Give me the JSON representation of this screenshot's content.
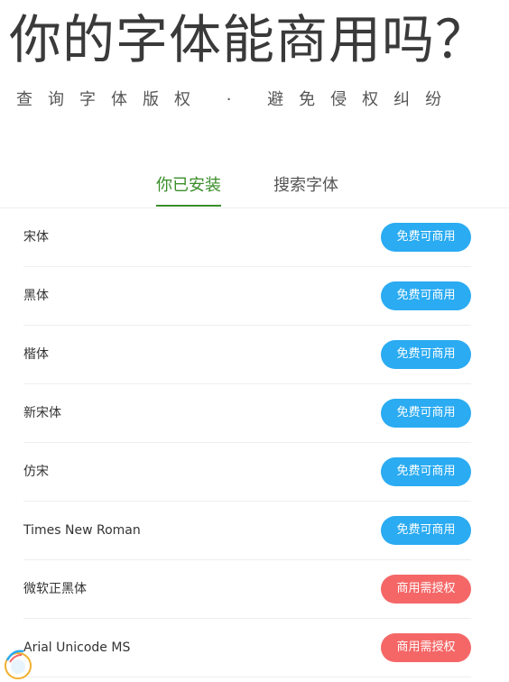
{
  "hero": {
    "title": "你的字体能商用吗？",
    "subtitle": "查询字体版权 · 避免侵权纠纷"
  },
  "tabs": [
    {
      "label": "你已安装",
      "active": true
    },
    {
      "label": "搜索字体",
      "active": false
    }
  ],
  "colors": {
    "accent_green": "#3a8e2a",
    "free_badge": "#2aabf2",
    "paid_badge": "#f56767"
  },
  "fonts": [
    {
      "name": "宋体",
      "license": "免费可商用",
      "status": "free"
    },
    {
      "name": "黑体",
      "license": "免费可商用",
      "status": "free"
    },
    {
      "name": "楷体",
      "license": "免费可商用",
      "status": "free"
    },
    {
      "name": "新宋体",
      "license": "免费可商用",
      "status": "free"
    },
    {
      "name": "仿宋",
      "license": "免费可商用",
      "status": "free"
    },
    {
      "name": "Times New Roman",
      "license": "免费可商用",
      "status": "free"
    },
    {
      "name": "微软正黑体",
      "license": "商用需授权",
      "status": "paid"
    },
    {
      "name": "Arial Unicode MS",
      "license": "商用需授权",
      "status": "paid"
    }
  ]
}
